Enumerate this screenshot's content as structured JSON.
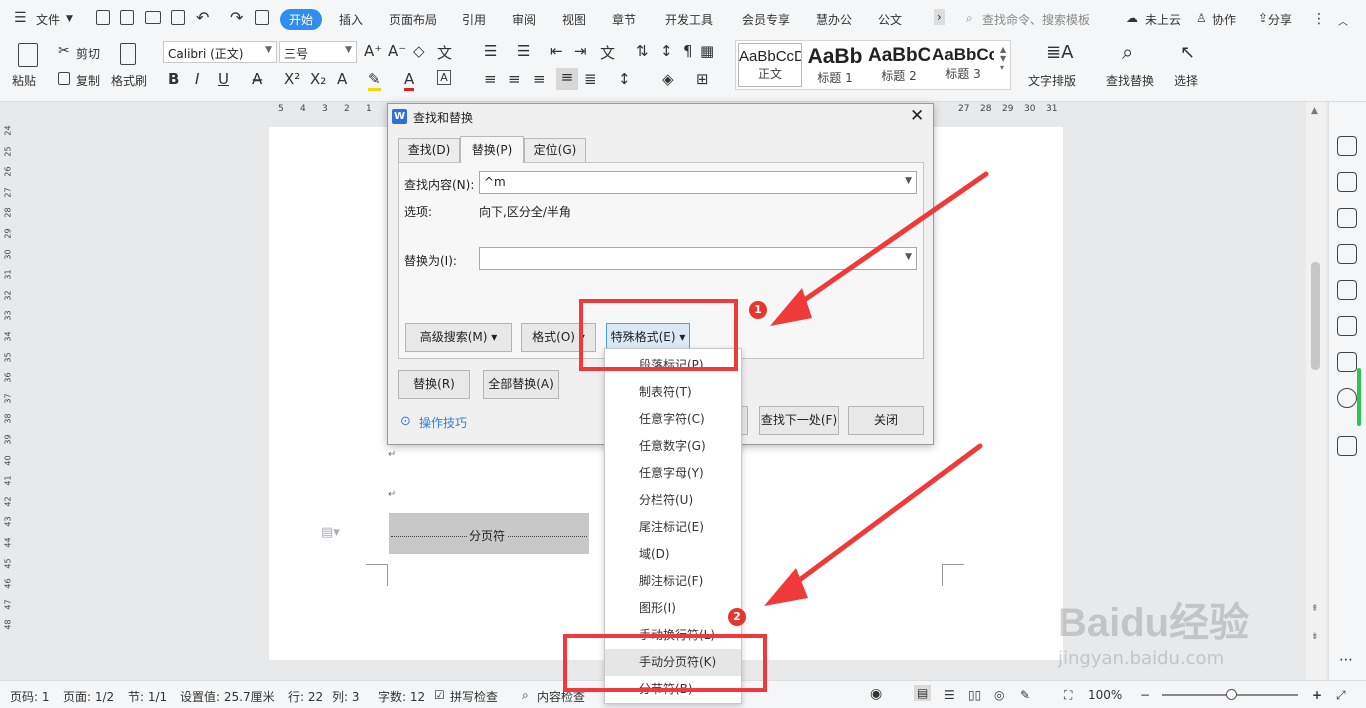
{
  "menubar": {
    "file": "文件",
    "tabs": [
      "开始",
      "插入",
      "页面布局",
      "引用",
      "审阅",
      "视图",
      "章节",
      "开发工具",
      "会员专享",
      "慧办公",
      "公文"
    ],
    "search_placeholder": "查找命令、搜索模板",
    "cloud": "未上云",
    "collab": "协作",
    "share": "分享"
  },
  "ribbon": {
    "paste": "粘贴",
    "cut": "剪切",
    "copy": "复制",
    "format_painter": "格式刷",
    "font_name": "Calibri (正文)",
    "font_size": "三号",
    "styles": [
      {
        "sample": "AaBbCcDd",
        "name": "正文"
      },
      {
        "sample": "AaBb",
        "name": "标题 1"
      },
      {
        "sample": "AaBbC",
        "name": "标题 2"
      },
      {
        "sample": "AaBbCc",
        "name": "标题 3"
      }
    ],
    "text_layout": "文字排版",
    "find_replace": "查找替换",
    "select": "选择"
  },
  "ruler": {
    "left": [
      "5",
      "4",
      "3",
      "2",
      "1"
    ],
    "right": [
      "27",
      "28",
      "29",
      "30",
      "31"
    ]
  },
  "vruler": [
    "24",
    "25",
    "26",
    "27",
    "28",
    "29",
    "30",
    "31",
    "32",
    "33",
    "34",
    "35",
    "36",
    "37",
    "38",
    "39",
    "40",
    "41",
    "42",
    "43",
    "44",
    "45",
    "46",
    "47",
    "48"
  ],
  "document": {
    "page_break_label": "分页符",
    "para_mark": "↵"
  },
  "dialog": {
    "title": "查找和替换",
    "tabs": [
      "查找(D)",
      "替换(P)",
      "定位(G)"
    ],
    "find_label": "查找内容(N):",
    "find_value": "^m",
    "options_label": "选项:",
    "options_value": "向下,区分全/半角",
    "replace_label": "替换为(I):",
    "replace_value": "",
    "advanced": "高级搜索(M)",
    "format": "格式(O)",
    "special": "特殊格式(E)",
    "replace": "替换(R)",
    "replace_all": "全部替换(A)",
    "tips": "操作技巧",
    "find_prev_partial": ")",
    "find_next": "查找下一处(F)",
    "close": "关闭"
  },
  "dropdown": {
    "items": [
      "段落标记(P)",
      "制表符(T)",
      "任意字符(C)",
      "任意数字(G)",
      "任意字母(Y)",
      "分栏符(U)",
      "尾注标记(E)",
      "域(D)",
      "脚注标记(F)",
      "图形(I)",
      "手动换行符(L)",
      "手动分页符(K)",
      "分节符(B)"
    ]
  },
  "annotations": {
    "badge1": "1",
    "badge2": "2"
  },
  "status": {
    "page_no": "页码: 1",
    "pages": "页面: 1/2",
    "section": "节: 1/1",
    "setting": "设置值: 25.7厘米",
    "row": "行: 22",
    "col": "列: 3",
    "words": "字数: 12",
    "spell": "拼写检查",
    "content_check": "内容检查",
    "zoom": "100%"
  },
  "watermark": {
    "brand": "Baidu经验",
    "url": "jingyan.baidu.com"
  }
}
